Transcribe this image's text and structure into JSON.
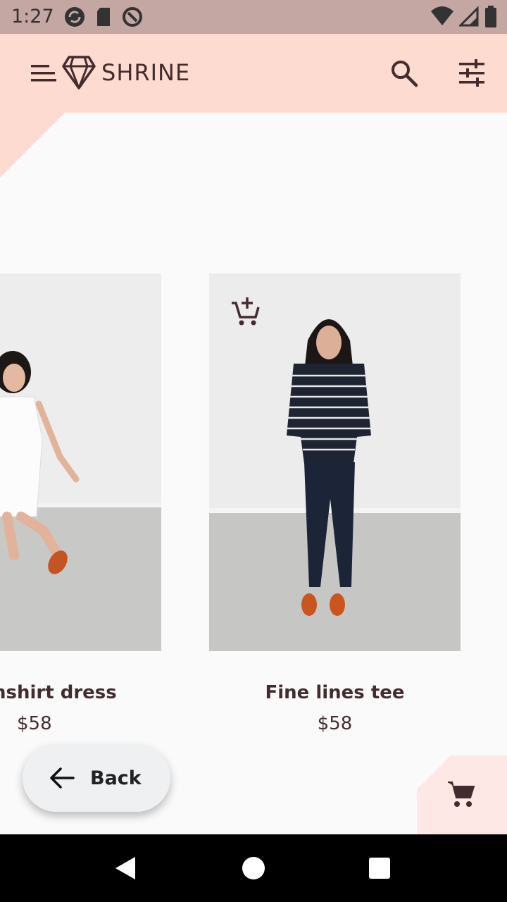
{
  "status_bar": {
    "time": "1:27",
    "icons": [
      "sync-icon",
      "sd-card-icon",
      "data-saver-icon",
      "wifi-icon",
      "signal-icon",
      "battery-icon"
    ]
  },
  "app_bar": {
    "title": "SHRINE",
    "icons": [
      "menu-icon",
      "diamond-icon",
      "search-icon",
      "tune-icon"
    ]
  },
  "products": [
    {
      "name": "Chambray shirt dress",
      "visible_name": "nshirt dress",
      "price": "$58",
      "image": "white-dress-photo"
    },
    {
      "name": "Fine lines tee",
      "price": "$58",
      "image": "striped-tee-photo"
    }
  ],
  "back_button": {
    "label": "Back"
  },
  "colors": {
    "app_bar": "#fedbd0",
    "text": "#442c2e",
    "status_bar": "#c4a7a2"
  }
}
